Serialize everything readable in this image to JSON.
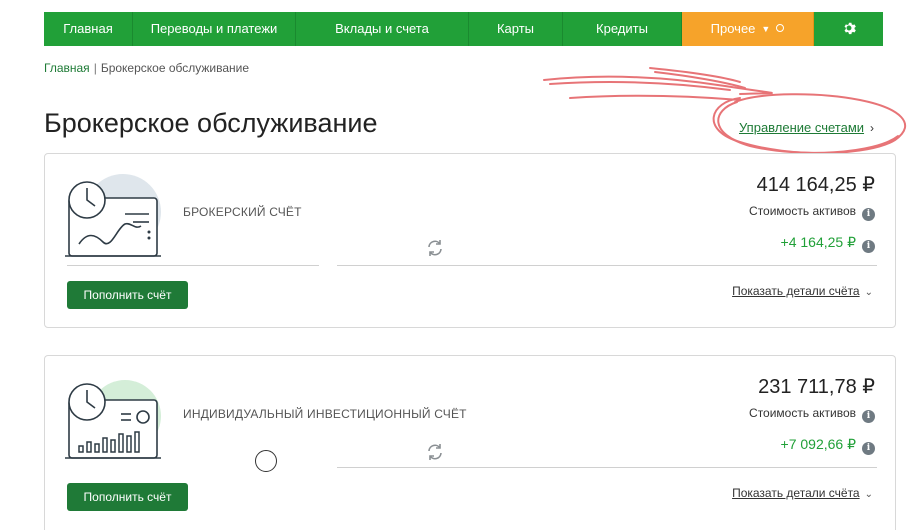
{
  "nav": {
    "items": [
      {
        "label": "Главная",
        "width": 0
      },
      {
        "label": "Переводы и платежи"
      },
      {
        "label": "Вклады и счета"
      },
      {
        "label": "Карты"
      },
      {
        "label": "Кредиты"
      },
      {
        "label": "Прочее"
      }
    ],
    "settings_icon": "gear-icon",
    "accent": "#21a038",
    "other_color": "#f6a32a"
  },
  "breadcrumb": {
    "home": "Главная",
    "separator": "|",
    "current": "Брокерское обслуживание"
  },
  "page": {
    "title": "Брокерское обслуживание",
    "manage_link": "Управление счетами"
  },
  "accounts": [
    {
      "name": "БРОКЕРСКИЙ СЧЁТ",
      "amount": "414 164,25 ₽",
      "assets_label": "Стоимость активов",
      "gain": "+4 164,25 ₽",
      "topup_label": "Пополнить счёт",
      "details_label": "Показать детали счёта"
    },
    {
      "name": "ИНДИВИДУАЛЬНЫЙ ИНВЕСТИЦИОННЫЙ СЧЁТ",
      "amount": "231 711,78 ₽",
      "assets_label": "Стоимость активов",
      "gain": "+7 092,66 ₽",
      "topup_label": "Пополнить счёт",
      "details_label": "Показать детали счёта"
    }
  ],
  "info_glyph": "i",
  "gain_color": "#21a038"
}
